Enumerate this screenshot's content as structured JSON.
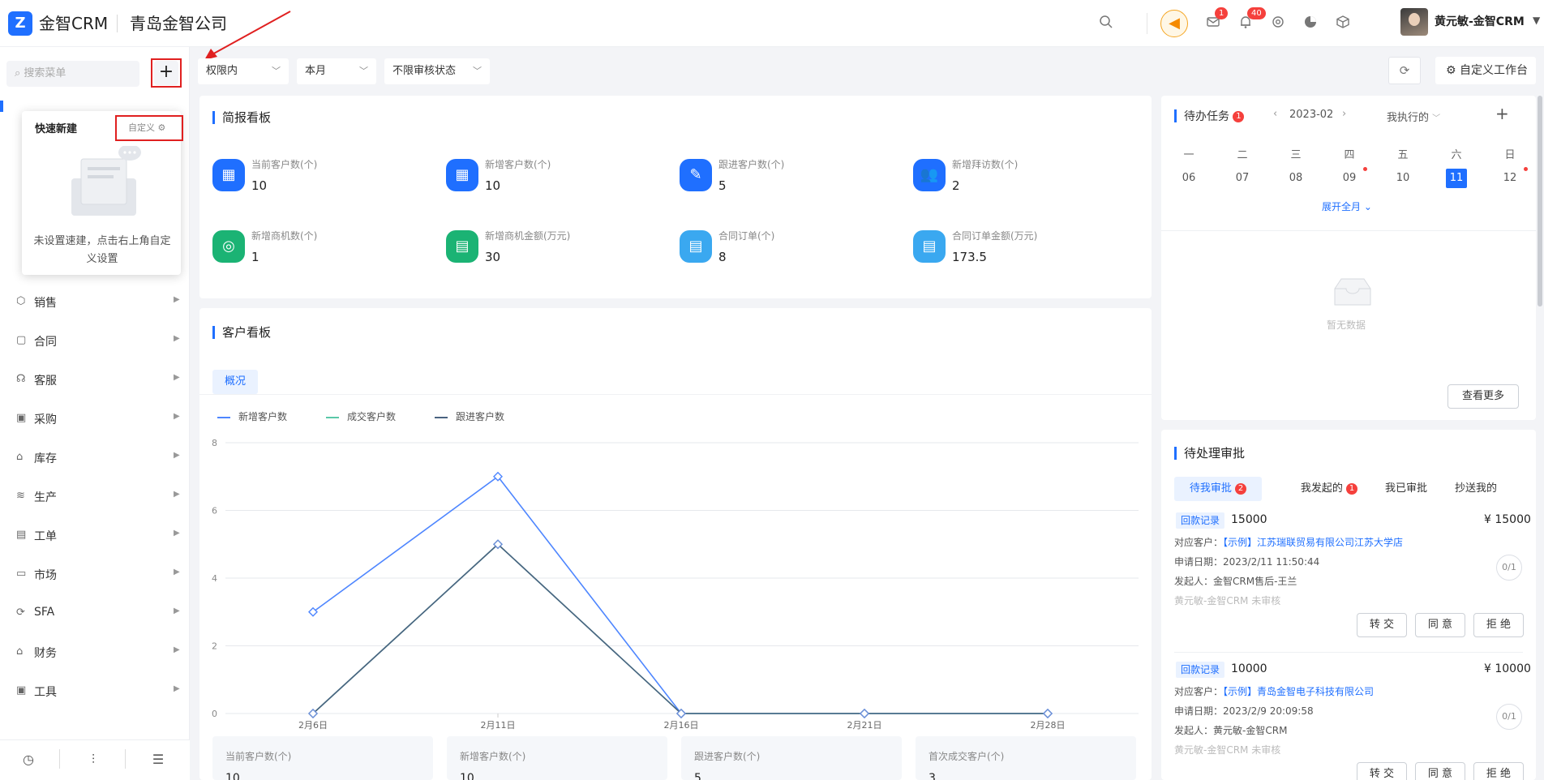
{
  "header": {
    "logo_mark": "Z",
    "logo_text": "金智CRM",
    "company": "青岛金智公司",
    "mail_badge": "1",
    "bell_badge": "40",
    "user_name": "黄元敏-金智CRM",
    "icons": [
      "search-icon",
      "speaker-icon",
      "mail-icon",
      "bell-icon",
      "gear-icon",
      "pie-chart-icon",
      "cube-icon"
    ]
  },
  "sidebar": {
    "search_placeholder": "搜索菜单",
    "plus_label": "+",
    "items": [
      {
        "label": "销售",
        "icon": "⬡"
      },
      {
        "label": "合同",
        "icon": "▢"
      },
      {
        "label": "客服",
        "icon": "☊"
      },
      {
        "label": "采购",
        "icon": "▣"
      },
      {
        "label": "库存",
        "icon": "⌂"
      },
      {
        "label": "生产",
        "icon": "≋"
      },
      {
        "label": "工单",
        "icon": "▤"
      },
      {
        "label": "市场",
        "icon": "▭"
      },
      {
        "label": "SFA",
        "icon": "⟳"
      },
      {
        "label": "财务",
        "icon": "⌂"
      },
      {
        "label": "工具",
        "icon": "▣"
      }
    ]
  },
  "quick_popup": {
    "title": "快速新建",
    "customize": "自定义",
    "message": "未设置速建，点击右上角自定义设置"
  },
  "filters": {
    "scope": "权限内",
    "period": "本月",
    "audit": "不限审核状态",
    "workbench": "自定义工作台"
  },
  "brief": {
    "title": "简报看板",
    "stats": [
      {
        "label": "当前客户数(个)",
        "value": "10",
        "color": "#1f6fff",
        "icon": "▦"
      },
      {
        "label": "新增客户数(个)",
        "value": "10",
        "color": "#1f6fff",
        "icon": "▦"
      },
      {
        "label": "跟进客户数(个)",
        "value": "5",
        "color": "#1f6fff",
        "icon": "✎"
      },
      {
        "label": "新增拜访数(个)",
        "value": "2",
        "color": "#1f6fff",
        "icon": "👥"
      },
      {
        "label": "新增商机数(个)",
        "value": "1",
        "color": "#1bb374",
        "icon": "◎"
      },
      {
        "label": "新增商机金额(万元)",
        "value": "30",
        "color": "#1bb374",
        "icon": "▤"
      },
      {
        "label": "合同订单(个)",
        "value": "8",
        "color": "#3aa8f0",
        "icon": "▤"
      },
      {
        "label": "合同订单金额(万元)",
        "value": "173.5",
        "color": "#3aa8f0",
        "icon": "▤"
      }
    ]
  },
  "customer_board": {
    "title": "客户看板",
    "tab": "概况",
    "summary": [
      {
        "label": "当前客户数(个)",
        "value": "10"
      },
      {
        "label": "新增客户数(个)",
        "value": "10"
      },
      {
        "label": "跟进客户数(个)",
        "value": "5"
      },
      {
        "label": "首次成交客户(个)",
        "value": "3"
      }
    ]
  },
  "chart_data": {
    "type": "line",
    "x": [
      "2月6日",
      "2月11日",
      "2月16日",
      "2月21日",
      "2月28日"
    ],
    "ylim": [
      0,
      8
    ],
    "yticks": [
      0,
      2,
      4,
      6,
      8
    ],
    "series": [
      {
        "name": "新增客户数",
        "color": "#4e86ff",
        "values": [
          3,
          7,
          0,
          0,
          0
        ]
      },
      {
        "name": "成交客户数",
        "color": "#5ac8a8",
        "values": [
          0,
          5,
          0,
          0,
          0
        ]
      },
      {
        "name": "跟进客户数",
        "color": "#4a6380",
        "values": [
          0,
          5,
          0,
          0,
          0
        ]
      }
    ],
    "grid": true,
    "legend": "top-left"
  },
  "todo": {
    "title": "待办任务",
    "badge": "1",
    "month": "2023-02",
    "filter": "我执行的",
    "weekdays": [
      "一",
      "二",
      "三",
      "四",
      "五",
      "六",
      "日"
    ],
    "days": [
      "06",
      "07",
      "08",
      "09",
      "10",
      "11",
      "12"
    ],
    "expand": "展开全月",
    "empty": "暂无数据",
    "more": "查看更多"
  },
  "approval": {
    "title": "待处理审批",
    "tabs": [
      {
        "label": "待我审批",
        "badge": "2"
      },
      {
        "label": "我发起的",
        "badge": "1"
      },
      {
        "label": "我已审批",
        "badge": ""
      },
      {
        "label": "抄送我的",
        "badge": ""
      }
    ],
    "items": [
      {
        "tag": "回款记录",
        "amount": "15000",
        "total": "¥ 15000",
        "customer_label": "对应客户：",
        "customer": "【示例】江苏瑞联贸易有限公司江苏大学店",
        "date_label": "申请日期：",
        "date": "2023/2/11 11:50:44",
        "initiator_label": "发起人：",
        "initiator": "金智CRM售后-王兰",
        "status": "黄元敏-金智CRM 未审核",
        "ratio": "0/1"
      },
      {
        "tag": "回款记录",
        "amount": "10000",
        "total": "¥ 10000",
        "customer_label": "对应客户：",
        "customer": "【示例】青岛金智电子科技有限公司",
        "date_label": "申请日期：",
        "date": "2023/2/9 20:09:58",
        "initiator_label": "发起人：",
        "initiator": "黄元敏-金智CRM",
        "status": "黄元敏-金智CRM 未审核",
        "ratio": "0/1"
      }
    ],
    "buttons": {
      "transfer": "转 交",
      "agree": "同 意",
      "reject": "拒 绝"
    }
  }
}
